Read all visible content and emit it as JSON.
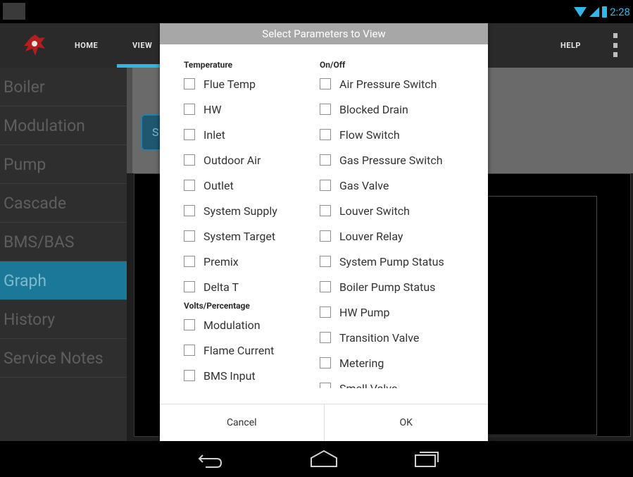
{
  "status_bar": {
    "time": "2:28"
  },
  "action_bar": {
    "tabs": [
      "HOME",
      "VIEW"
    ],
    "help_label": "HELP"
  },
  "sidebar": {
    "items": [
      "Boiler",
      "Modulation",
      "Pump",
      "Cascade",
      "BMS/BAS",
      "Graph",
      "History",
      "Service Notes"
    ],
    "active": "Graph"
  },
  "content": {
    "partial_button_label": "S"
  },
  "dialog": {
    "title": "Select Parameters to View",
    "left_column": {
      "temperature_header": "Temperature",
      "temperature_items": [
        "Flue Temp",
        "HW",
        "Inlet",
        "Outdoor Air",
        "Outlet",
        "System Supply",
        "System Target",
        "Premix",
        "Delta T"
      ],
      "volts_header": "Volts/Percentage",
      "volts_items": [
        "Modulation",
        "Flame Current",
        "BMS Input"
      ]
    },
    "right_column": {
      "onoff_header": "On/Off",
      "onoff_items": [
        "Air Pressure Switch",
        "Blocked Drain",
        "Flow Switch",
        "Gas Pressure Switch",
        "Gas Valve",
        "Louver Switch",
        "Louver Relay",
        "System Pump Status",
        "Boiler Pump Status",
        "HW Pump",
        "Transition Valve",
        "Metering",
        "Smell Valve"
      ]
    },
    "cancel_label": "Cancel",
    "ok_label": "OK"
  },
  "colors": {
    "accent": "#33b5e5",
    "sidebar_active": "#1b7898",
    "dialog_title_bg": "#a7a7a7"
  }
}
